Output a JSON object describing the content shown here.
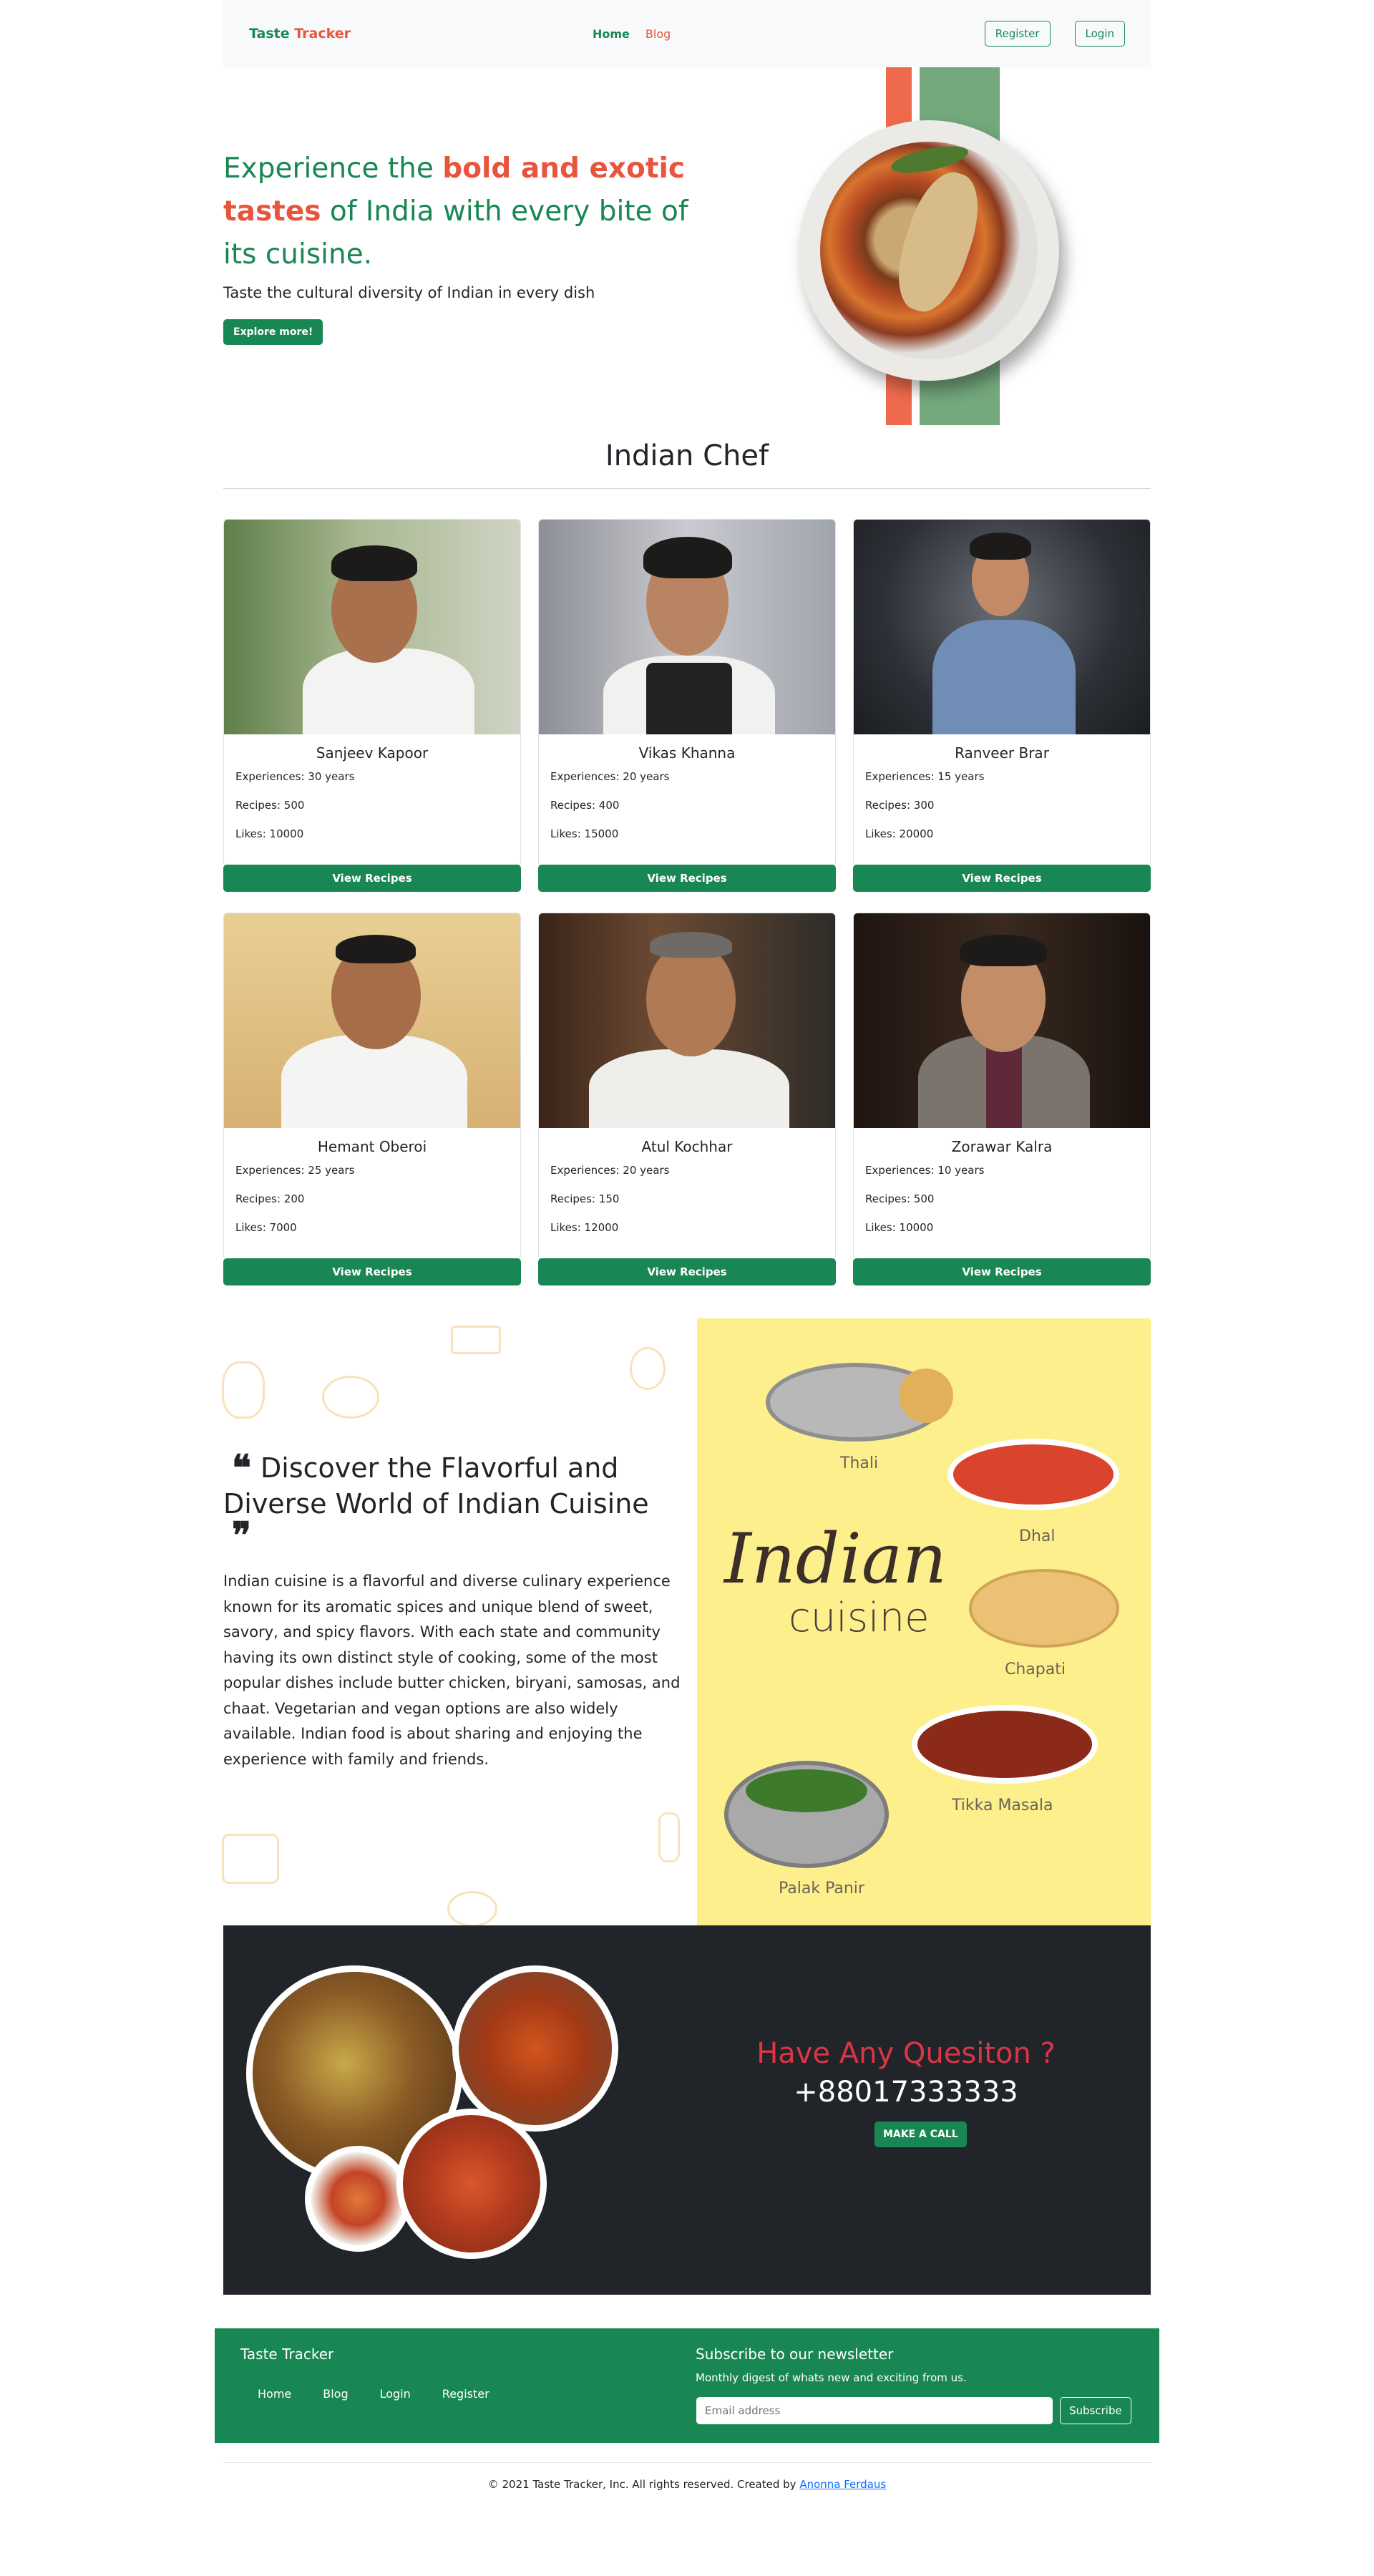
{
  "navbar": {
    "brand_part1": "Taste",
    "brand_part2": "Tracker",
    "links": [
      "Home",
      "Blog"
    ],
    "register_label": "Register",
    "login_label": "Login"
  },
  "hero": {
    "title_part1": "Experience the ",
    "title_highlight": "bold and exotic tastes",
    "title_part2": " of India with every bite of its cuisine.",
    "subtitle": "Taste the cultural diversity of Indian in every dish",
    "cta_label": "Explore more!"
  },
  "chefs_section": {
    "title": "Indian Chef",
    "button_label": "View Recipes",
    "chefs": [
      {
        "name": "Sanjeev Kapoor",
        "experience": "Experiences: 30 years",
        "recipes": "Recipes: 500",
        "likes": "Likes: 10000"
      },
      {
        "name": "Vikas Khanna",
        "experience": "Experiences: 20 years",
        "recipes": "Recipes: 400",
        "likes": "Likes: 15000"
      },
      {
        "name": "Ranveer Brar",
        "experience": "Experiences: 15 years",
        "recipes": "Recipes: 300",
        "likes": "Likes: 20000"
      },
      {
        "name": "Hemant Oberoi",
        "experience": "Experiences: 25 years",
        "recipes": "Recipes: 200",
        "likes": "Likes: 7000"
      },
      {
        "name": "Atul Kochhar",
        "experience": "Experiences: 20 years",
        "recipes": "Recipes: 150",
        "likes": "Likes: 12000"
      },
      {
        "name": "Zorawar Kalra",
        "experience": "Experiences: 10 years",
        "recipes": "Recipes: 500",
        "likes": "Likes: 10000"
      }
    ]
  },
  "cuisine": {
    "heading": "Discover the Flavorful and Diverse World of Indian Cuisine",
    "text": "Indian cuisine is a flavorful and diverse culinary experience known for its aromatic spices and unique blend of sweet, savory, and spicy flavors. With each state and community having its own distinct style of cooking, some of the most popular dishes include butter chicken, biryani, samosas, and chaat. Vegetarian and vegan options are also widely available. Indian food is about sharing and enjoying the experience with family and friends.",
    "poster_title": "Indian",
    "poster_subtitle": "cuisine",
    "dishes": [
      "Thali",
      "Dhal",
      "Chapati",
      "Tikka Masala",
      "Palak Panir"
    ]
  },
  "question": {
    "title": "Have Any Quesiton ?",
    "phone": "+88017333333",
    "call_label": "MAKE A CALL"
  },
  "footer": {
    "brand": "Taste Tracker",
    "links": [
      "Home",
      "Blog",
      "Login",
      "Register"
    ],
    "newsletter_title": "Subscribe to our newsletter",
    "newsletter_desc": "Monthly digest of whats new and exciting from us.",
    "email_placeholder": "Email address",
    "subscribe_label": "Subscribe",
    "copyright_text": "© 2021 Taste Tracker, Inc. All rights reserved. Created by ",
    "author": "Anonna Ferdaus"
  },
  "colors": {
    "primary_green": "#198754",
    "accent_orange": "#e8553c",
    "question_red": "#dc3545",
    "dark_bg": "#212529",
    "poster_yellow": "#fdf08c"
  }
}
